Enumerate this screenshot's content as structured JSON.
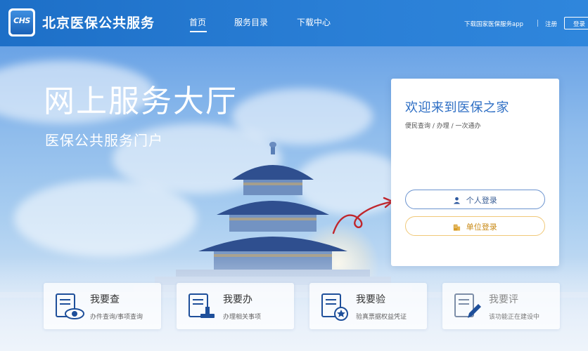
{
  "header": {
    "logo_text": "CHS",
    "site_title": "北京医保公共服务",
    "nav": [
      {
        "label": "首页"
      },
      {
        "label": "服务目录"
      },
      {
        "label": "下载中心"
      }
    ],
    "app_link": "下载国家医保服务app",
    "register": "注册",
    "login": "登录"
  },
  "hero": {
    "title": "网上服务大厅",
    "subtitle": "医保公共服务门户"
  },
  "card": {
    "title": "欢迎来到医保之家",
    "subtitle": "便民查询 / 办理 / 一次通办",
    "personal_login": "个人登录",
    "unit_login": "单位登录"
  },
  "tiles": [
    {
      "title": "我要查",
      "desc": "办件查询/事项查询"
    },
    {
      "title": "我要办",
      "desc": "办理相关事项"
    },
    {
      "title": "我要验",
      "desc": "验真票据权益凭证"
    },
    {
      "title": "我要评",
      "desc": "该功能正在建设中"
    }
  ],
  "colors": {
    "header_blue": "#1d6fc7",
    "card_title_blue": "#2d6ec4",
    "unit_orange": "#c98a16",
    "arrow_red": "#c0262c"
  },
  "icons": {
    "tile_0": "document-eye-icon",
    "tile_1": "document-stamp-icon",
    "tile_2": "document-star-icon",
    "tile_3": "document-pen-icon",
    "personal": "user-icon",
    "unit": "building-icon"
  }
}
